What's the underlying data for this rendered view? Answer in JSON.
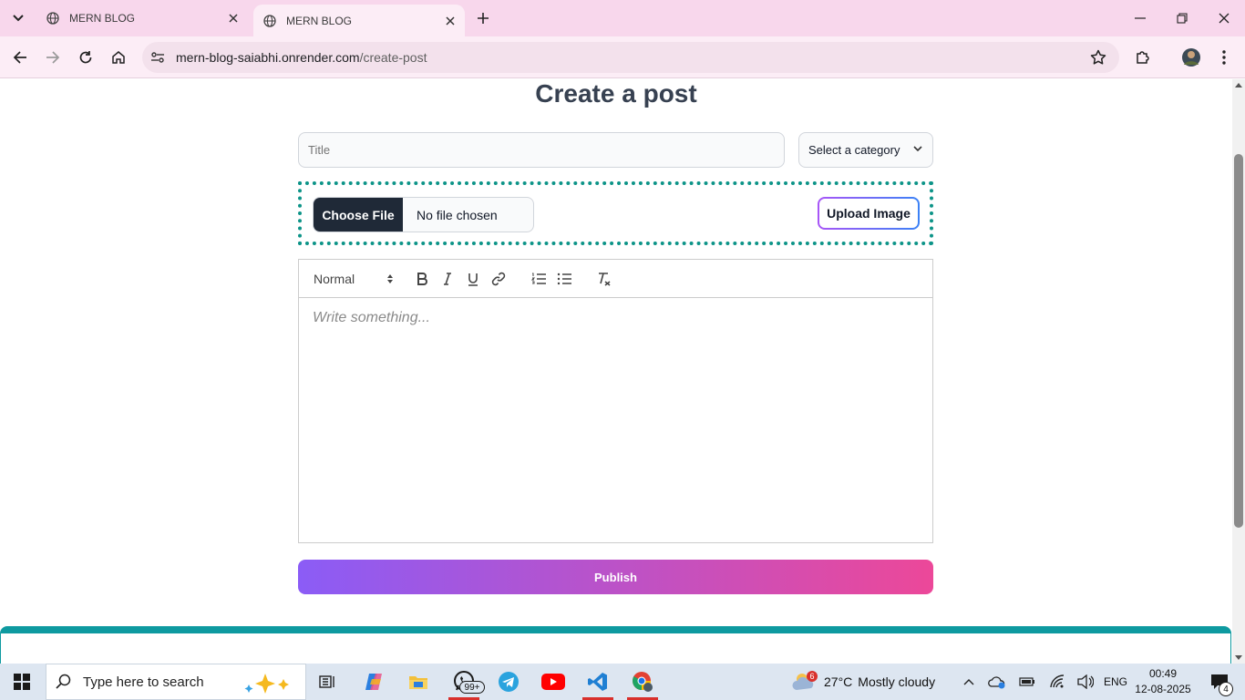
{
  "browser": {
    "tabs": [
      {
        "title": "MERN BLOG",
        "active": false
      },
      {
        "title": "MERN BLOG",
        "active": true
      }
    ],
    "url_host": "mern-blog-saiabhi.onrender.com",
    "url_path": "/create-post"
  },
  "page": {
    "title": "Create a post",
    "title_placeholder": "Title",
    "category_label": "Select a category",
    "choose_file_label": "Choose File",
    "file_status": "No file chosen",
    "upload_button": "Upload Image",
    "editor": {
      "header_select": "Normal",
      "placeholder": "Write something..."
    },
    "publish_button": "Publish"
  },
  "taskbar": {
    "search_placeholder": "Type here to search",
    "whatsapp_badge": "99+",
    "weather_badge": "6",
    "weather_temp": "27°C",
    "weather_text": "Mostly cloudy",
    "language": "ENG",
    "time": "00:49",
    "date": "12-08-2025",
    "notification_count": "4"
  },
  "colors": {
    "tabstrip": "#f8d7ec",
    "accent_teal": "#0d9488",
    "publish_from": "#8b5cf6",
    "publish_to": "#ec4899"
  }
}
